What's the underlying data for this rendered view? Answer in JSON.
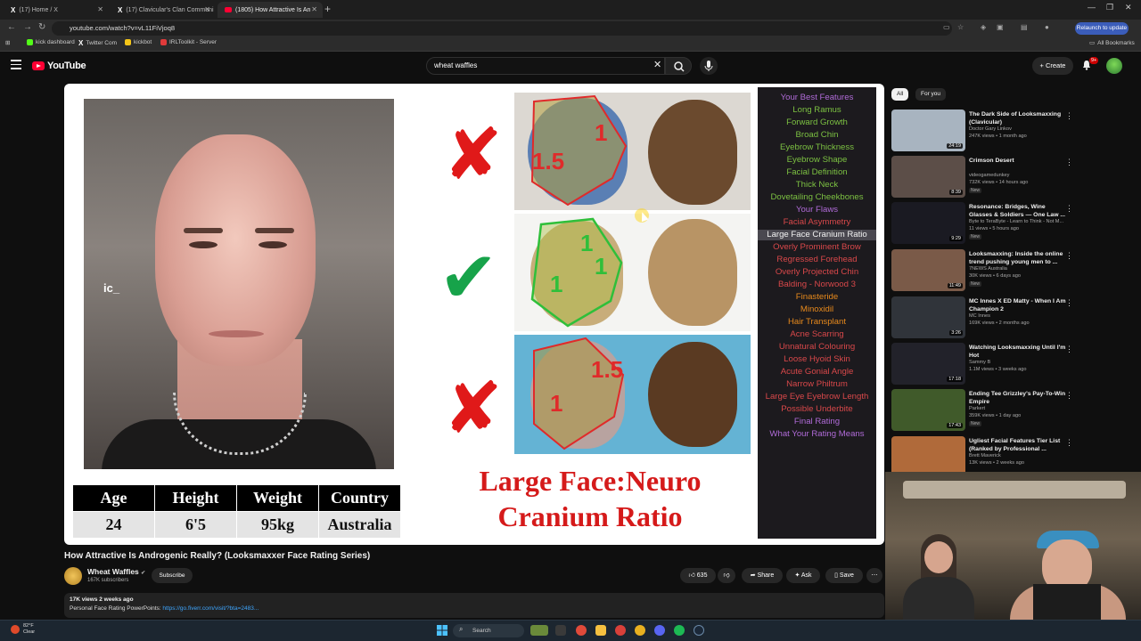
{
  "browser": {
    "tabs": [
      {
        "label": "(17) Home / X",
        "icon": "x-icon"
      },
      {
        "label": "(17) Clavicular's Clan Communi",
        "icon": "x-icon"
      },
      {
        "label": "(1805) How Attractive Is An",
        "icon": "youtube-icon"
      }
    ],
    "url": "youtube.com/watch?v=vL11FiVjoq8",
    "relaunch_label": "Relaunch to update",
    "bookmarks": [
      {
        "label": "kick dashboard",
        "color": "#53fc18"
      },
      {
        "label": "Twitter Com",
        "color": "#ffffff"
      },
      {
        "label": "kickbot",
        "color": "#f5c518"
      },
      {
        "label": "IRLToolkit - Server",
        "color": "#e03a3a"
      }
    ],
    "all_bookmarks_label": "All Bookmarks"
  },
  "youtube": {
    "logo_text": "YouTube",
    "search_value": "wheat waffles",
    "create_label": "Create",
    "notif_badge": "9+"
  },
  "video": {
    "overlay_text": "ic_",
    "stats": {
      "headers": [
        "Age",
        "Height",
        "Weight",
        "Country"
      ],
      "values": [
        "24",
        "6'5",
        "95kg",
        "Australia"
      ]
    },
    "ratio_labels": {
      "top_left": "1",
      "top_right": "1",
      "top_bottom": "1.5",
      "mid_a": "1",
      "mid_b": "1",
      "mid_c": "1",
      "bot_top": "1.5",
      "bot_bottom": "1"
    },
    "big_title_line1": "Large Face:Neuro",
    "big_title_line2": "Cranium Ratio",
    "feature_panel": [
      {
        "text": "Your Best Features",
        "style": "head"
      },
      {
        "text": "Long Ramus",
        "style": "green"
      },
      {
        "text": "Forward Growth",
        "style": "green"
      },
      {
        "text": "Broad Chin",
        "style": "green"
      },
      {
        "text": "Eyebrow Thickness",
        "style": "green"
      },
      {
        "text": "Eyebrow Shape",
        "style": "green"
      },
      {
        "text": "Facial Definition",
        "style": "green"
      },
      {
        "text": "Thick Neck",
        "style": "green"
      },
      {
        "text": "Dovetailing Cheekbones",
        "style": "green"
      },
      {
        "text": "Your Flaws",
        "style": "head"
      },
      {
        "text": "Facial Asymmetry",
        "style": "red"
      },
      {
        "text": "Large Face Cranium Ratio",
        "style": "sel"
      },
      {
        "text": "Overly Prominent Brow",
        "style": "red"
      },
      {
        "text": "Regressed Forehead",
        "style": "red"
      },
      {
        "text": "Overly Projected Chin",
        "style": "red"
      },
      {
        "text": "Balding - Norwood 3",
        "style": "red"
      },
      {
        "text": "Finasteride",
        "style": "orange"
      },
      {
        "text": "Minoxidil",
        "style": "orange"
      },
      {
        "text": "Hair Transplant",
        "style": "orange"
      },
      {
        "text": "Acne Scarring",
        "style": "red"
      },
      {
        "text": "Unnatural Colouring",
        "style": "red"
      },
      {
        "text": "Loose Hyoid Skin",
        "style": "red"
      },
      {
        "text": "Acute Gonial Angle",
        "style": "red"
      },
      {
        "text": "Narrow Philtrum",
        "style": "red"
      },
      {
        "text": "Large Eye Eyebrow Length",
        "style": "red"
      },
      {
        "text": "Possible Underbite",
        "style": "red"
      },
      {
        "text": "Final Rating",
        "style": "head"
      },
      {
        "text": "What Your Rating Means",
        "style": "head"
      }
    ],
    "title": "How Attractive Is Androgenic Really? (Looksmaxxer Face Rating Series)",
    "channel": "Wheat Waffles",
    "subscribers": "167K subscribers",
    "subscribe_label": "Subscribe",
    "likes": "635",
    "share_label": "Share",
    "ask_label": "Ask",
    "save_label": "Save",
    "desc_meta": "17K views  2 weeks ago",
    "desc_text": "Personal Face Rating PowerPoints: ",
    "desc_link": "https://go.fiverr.com/visit/?bta=2483..."
  },
  "sidebar": {
    "chips": [
      "All",
      "For you"
    ],
    "recommendations": [
      {
        "title": "The Dark Side of Looksmaxxing (Clavicular)",
        "channel": "Doctor Gary Linkov",
        "meta": "247K views • 1 month ago",
        "duration": "24:19",
        "thumb_color": "#a8b4c0",
        "new": ""
      },
      {
        "title": "Crimson Desert",
        "channel": "videogamedunkey",
        "meta": "732K views • 14 hours ago",
        "duration": "8:39",
        "thumb_color": "#5c4e48",
        "new": "New"
      },
      {
        "title": "Resonance: Bridges, Wine Glasses & Soldiers — One Law ...",
        "channel": "Byte to TeraByte - Learn to Think - Not M...",
        "meta": "11 views • 5 hours ago",
        "duration": "9:29",
        "thumb_color": "#1a1a22",
        "new": "New"
      },
      {
        "title": "Looksmaxxing: Inside the online trend pushing young men to ...",
        "channel": "7NEWS Australia",
        "meta": "30K views • 6 days ago",
        "duration": "11:49",
        "thumb_color": "#7a5a48",
        "new": "New"
      },
      {
        "title": "MC Innes X ED Matty - When I Am Champion 2",
        "channel": "MC Innes",
        "meta": "169K views • 2 months ago",
        "duration": "3:26",
        "thumb_color": "#30343a",
        "new": ""
      },
      {
        "title": "Watching Looksmaxxing Until I'm Hot",
        "channel": "Sammy B",
        "meta": "1.1M views • 3 weeks ago",
        "duration": "17:18",
        "thumb_color": "#22222a",
        "new": ""
      },
      {
        "title": "Ending Tee Grizzley's Pay-To-Win Empire",
        "channel": "Parkert",
        "meta": "359K views • 1 day ago",
        "duration": "17:43",
        "thumb_color": "#405a2a",
        "new": "New"
      },
      {
        "title": "Ugliest Facial Features Tier List (Ranked by Professional ...",
        "channel": "Brett Maverick",
        "meta": "13K views • 2 weeks ago",
        "duration": "",
        "thumb_color": "#b06a3a",
        "new": ""
      }
    ]
  },
  "taskbar": {
    "temp": "82°F",
    "condition": "Clear",
    "search_label": "Search"
  }
}
